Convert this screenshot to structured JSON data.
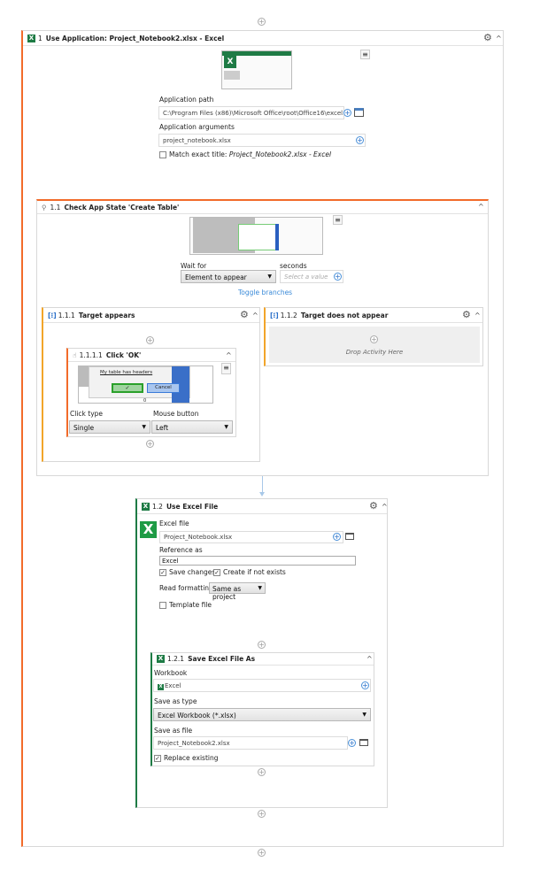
{
  "use_app": {
    "num": "1",
    "title": "Use Application: Project_Notebook2.xlsx - Excel",
    "app_path_label": "Application path",
    "app_path": "C:\\Program Files (x86)\\Microsoft Office\\root\\Office16\\excel....",
    "app_args_label": "Application arguments",
    "app_args": "project_notebook.xlsx",
    "match_label": "Match exact title: ",
    "match_title": "Project_Notebook2.xlsx - Excel"
  },
  "check_state": {
    "num": "1.1",
    "title": "Check App State 'Create Table'",
    "wait_for_label": "Wait for",
    "wait_for": "Element to appear",
    "seconds_label": "seconds",
    "seconds_placeholder": "Select a value",
    "toggle": "Toggle branches"
  },
  "target_appears": {
    "num": "1.1.1",
    "title": "Target appears"
  },
  "click_ok": {
    "num": "1.1.1.1",
    "title": "Click 'OK'",
    "click_type_label": "Click type",
    "click_type": "Single",
    "mouse_button_label": "Mouse button",
    "mouse_button": "Left",
    "thumb_checkbox": "My table has headers",
    "thumb_cancel": "Cancel",
    "thumb_zero": "0"
  },
  "target_not": {
    "num": "1.1.2",
    "title": "Target does not appear",
    "drop": "Drop Activity Here"
  },
  "use_excel": {
    "num": "1.2",
    "title": "Use Excel File",
    "file_label": "Excel file",
    "file": "Project_Notebook.xlsx",
    "ref_label": "Reference as",
    "ref": "Excel",
    "save_changes": "Save changes",
    "create": "Create if not exists",
    "read_fmt_label": "Read formatting",
    "read_fmt": "Same as project",
    "template": "Template file"
  },
  "save_as": {
    "num": "1.2.1",
    "title": "Save Excel File As",
    "workbook_label": "Workbook",
    "workbook": "Excel",
    "type_label": "Save as type",
    "type": "Excel Workbook (*.xlsx)",
    "file_label": "Save as file",
    "file": "Project_Notebook2.xlsx",
    "replace": "Replace existing"
  },
  "colors": {
    "orange": "#f26b2a",
    "green": "#1e7b45",
    "link": "#3a8ad8"
  }
}
